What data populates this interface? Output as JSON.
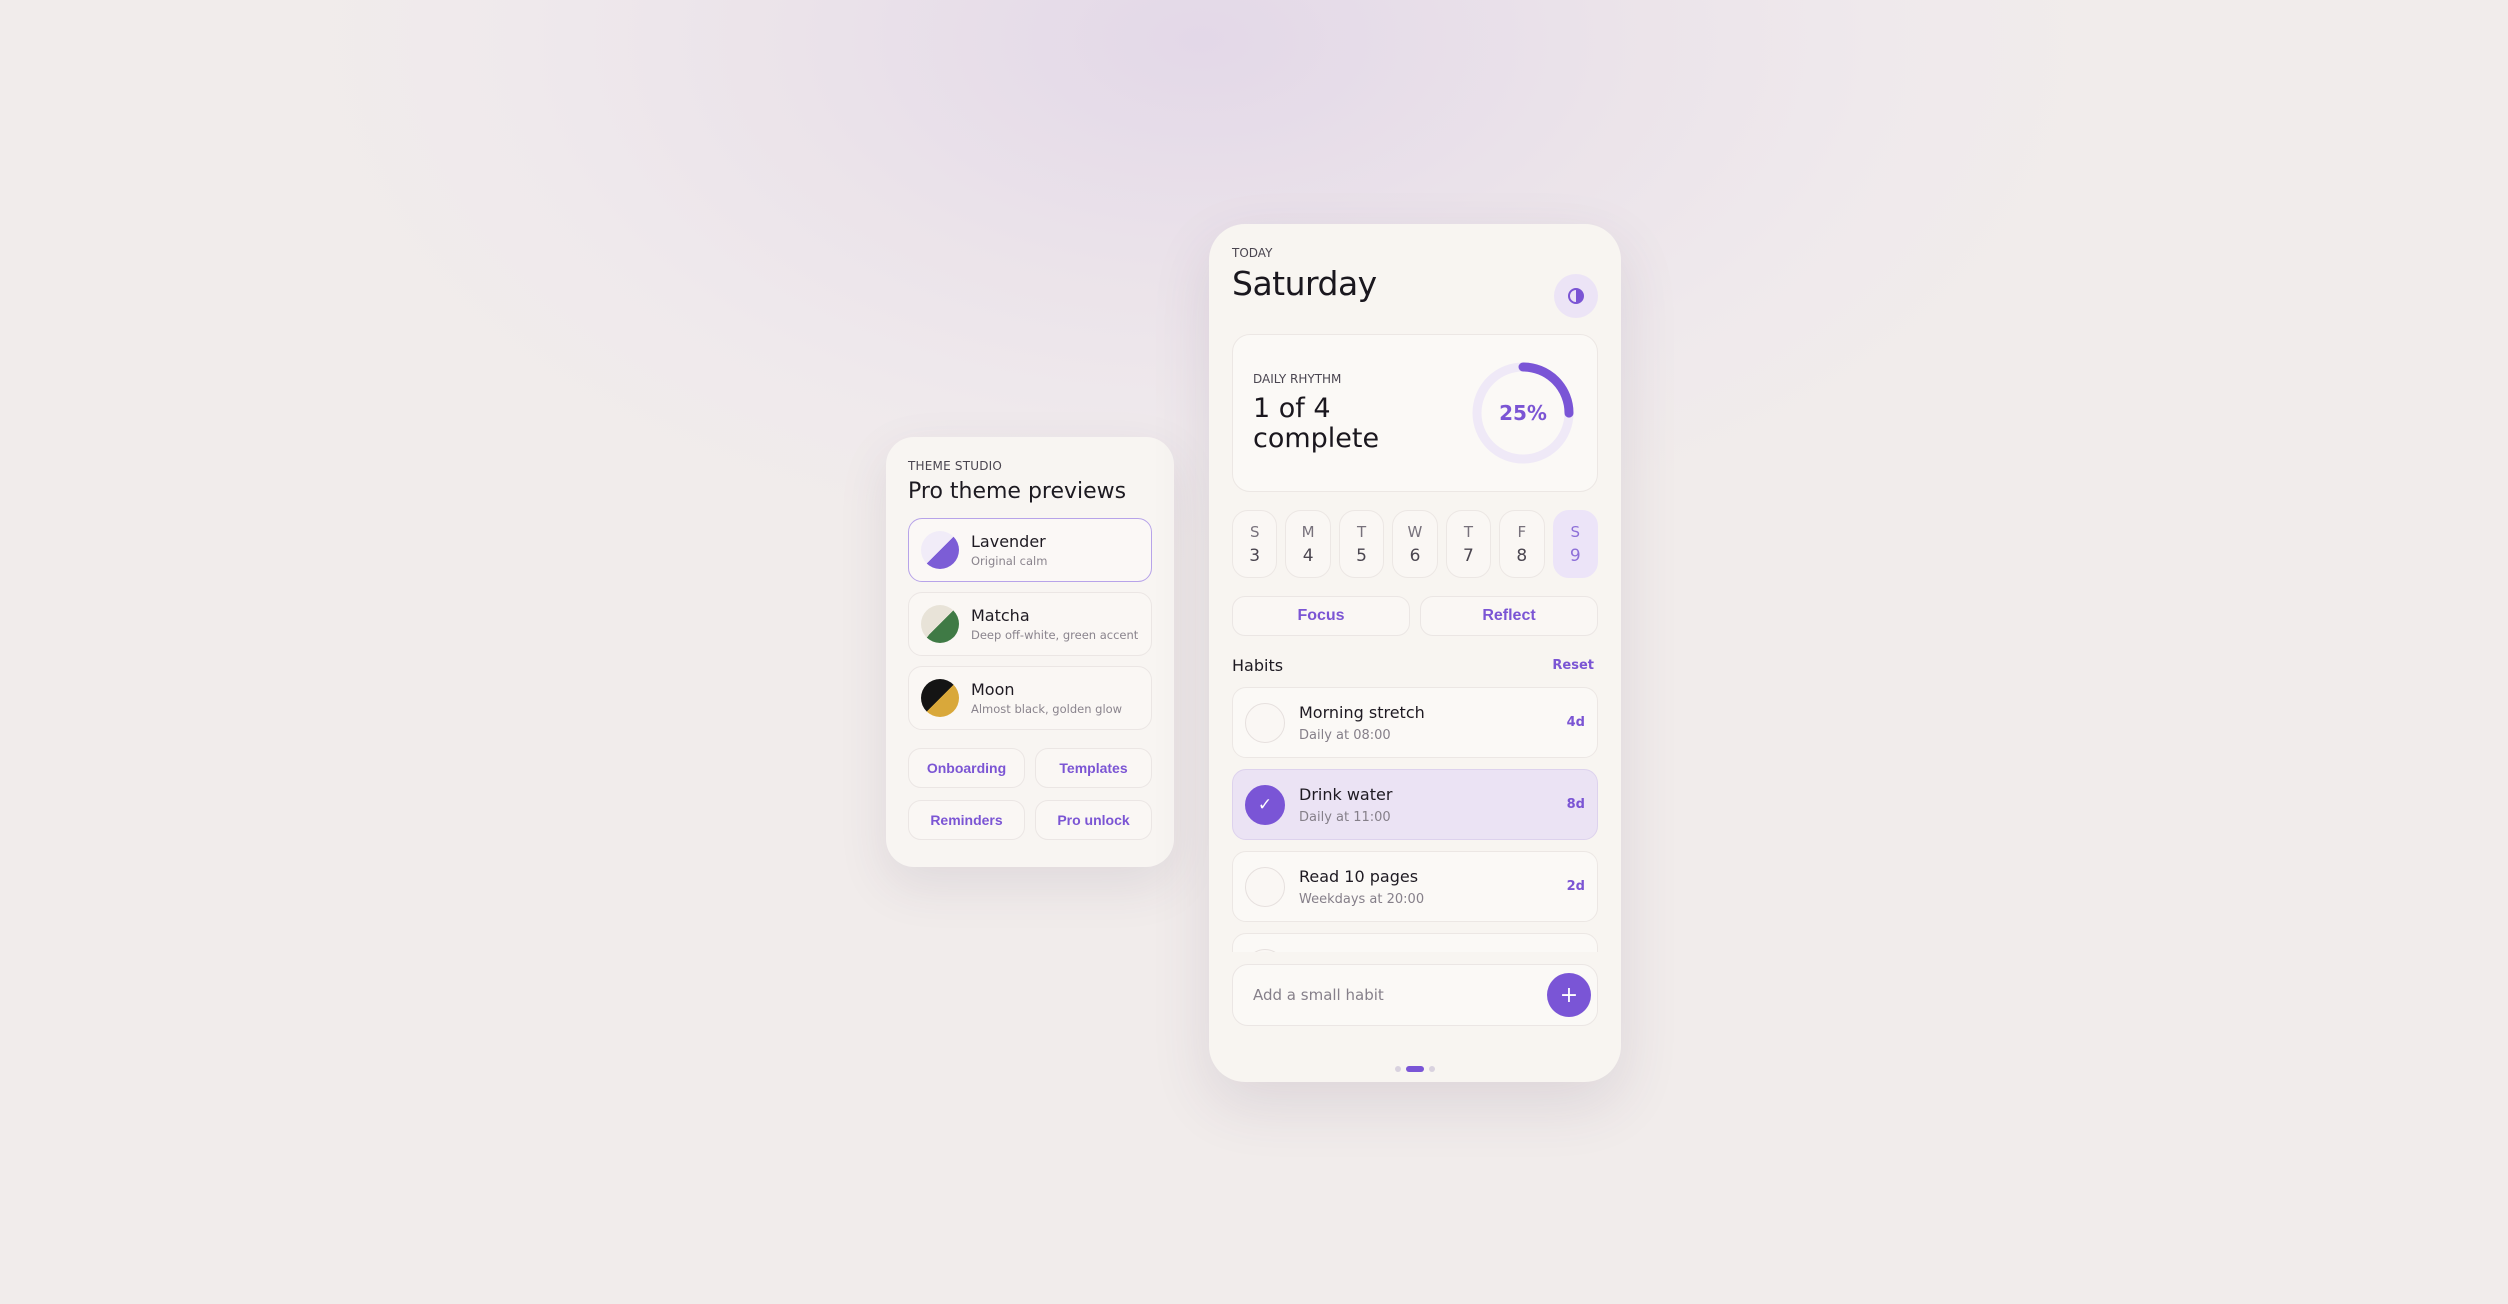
{
  "studio": {
    "eyebrow": "THEME STUDIO",
    "title": "Pro theme previews",
    "themes": [
      {
        "name": "Lavender",
        "subtitle": "Original calm",
        "icon": "lavender-swatch-icon",
        "colors": [
          "#f1ecf8",
          "#7c5dd6"
        ]
      },
      {
        "name": "Matcha",
        "subtitle": "Deep off-white, green accent",
        "icon": "matcha-swatch-icon",
        "colors": [
          "#e8e3d8",
          "#3f7a45"
        ]
      },
      {
        "name": "Moon",
        "subtitle": "Almost black, golden glow",
        "icon": "moon-swatch-icon",
        "colors": [
          "#141414",
          "#d9a83a"
        ]
      }
    ],
    "selected_theme": "Lavender",
    "links": [
      "Onboarding",
      "Templates",
      "Reminders",
      "Pro unlock"
    ]
  },
  "phone": {
    "eyebrow": "TODAY",
    "day": "Saturday",
    "toggle_icon": "contrast-icon",
    "rhythm": {
      "eyebrow": "DAILY RHYTHM",
      "summary": "1 of 4 complete",
      "percent_label": "25%",
      "progress": 0.25
    },
    "week": [
      {
        "letter": "S",
        "num": "3"
      },
      {
        "letter": "M",
        "num": "4"
      },
      {
        "letter": "T",
        "num": "5"
      },
      {
        "letter": "W",
        "num": "6"
      },
      {
        "letter": "T",
        "num": "7"
      },
      {
        "letter": "F",
        "num": "8"
      },
      {
        "letter": "S",
        "num": "9"
      }
    ],
    "active_day": "9",
    "modes": [
      "Focus",
      "Reflect"
    ],
    "habits_title": "Habits",
    "reset_label": "Reset",
    "habits": [
      {
        "name": "Morning stretch",
        "schedule": "Daily at 08:00",
        "streak": "4d",
        "done": false
      },
      {
        "name": "Drink water",
        "schedule": "Daily at 11:00",
        "streak": "8d",
        "done": true
      },
      {
        "name": "Read 10 pages",
        "schedule": "Weekdays at 20:00",
        "streak": "2d",
        "done": false
      }
    ],
    "add_placeholder": "Add a small habit",
    "add_icon": "plus-icon",
    "check_icon": "checkmark-icon",
    "pager": {
      "count": 3,
      "active": 2
    }
  },
  "colors": {
    "accent": "#7a55d6",
    "accent_soft": "#ece4f8",
    "card": "#f8f5f1"
  }
}
